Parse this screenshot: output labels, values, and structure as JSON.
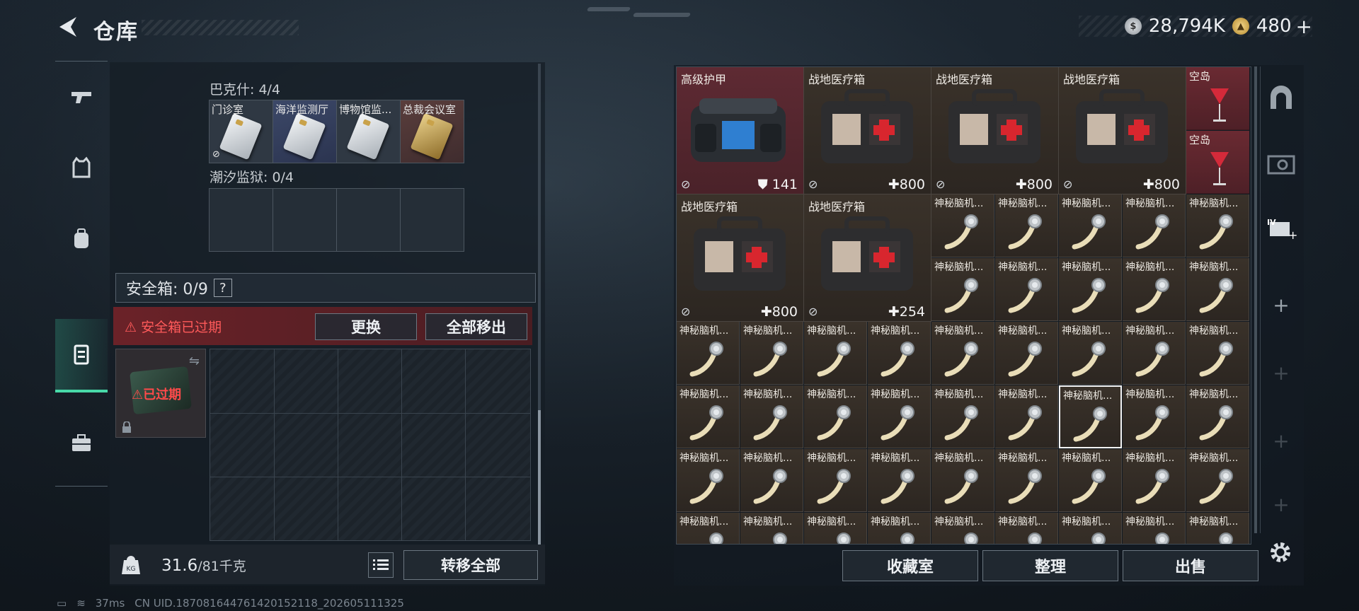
{
  "header": {
    "title": "仓库",
    "silver": "28,794K",
    "gold": "480",
    "gold_plus": "+"
  },
  "left": {
    "section1_label": "巴克什: 4/4",
    "keys": [
      {
        "name": "门诊室"
      },
      {
        "name": "海洋监测厅"
      },
      {
        "name": "博物馆监..."
      },
      {
        "name": "总裁会议室"
      }
    ],
    "section2_label": "潮汐监狱: 0/4",
    "safe_label": "安全箱: 0/9",
    "help": "?",
    "warn": "安全箱已过期",
    "replace_btn": "更换",
    "remove_all_btn": "全部移出",
    "expired": "已过期",
    "weight_current": "31.6",
    "weight_max": "/81千克",
    "transfer_all": "转移全部"
  },
  "stash": {
    "big_items": [
      {
        "name": "高级护甲",
        "value": "141",
        "kind": "armor"
      },
      {
        "name": "战地医疗箱",
        "value": "800",
        "kind": "medkit"
      },
      {
        "name": "战地医疗箱",
        "value": "800",
        "kind": "medkit"
      },
      {
        "name": "战地医疗箱",
        "value": "800",
        "kind": "medkit"
      },
      {
        "name": "战地医疗箱",
        "value": "800",
        "kind": "medkit"
      },
      {
        "name": "战地医疗箱",
        "value": "254",
        "kind": "medkit"
      }
    ],
    "small_items": [
      {
        "name": "空岛"
      },
      {
        "name": "空岛"
      }
    ],
    "implant_name": "神秘脑机...",
    "buttons": {
      "collection": "收藏室",
      "sort": "整理",
      "sell": "出售"
    }
  },
  "status": {
    "ping": "37ms",
    "uid": "CN UID.18708164476142015211​8_202605111325"
  },
  "colors": {
    "accent": "#48d9a8",
    "warning": "#ff5a5a",
    "armor_bg": "#5e2a33"
  }
}
